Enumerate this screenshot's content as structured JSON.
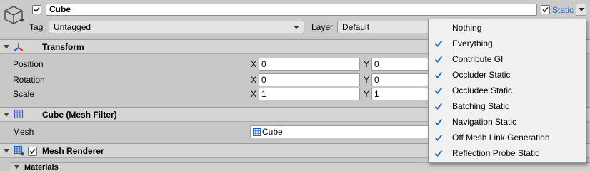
{
  "header": {
    "active": true,
    "name": "Cube",
    "static_label": "Static",
    "static_checked": true,
    "tag_label": "Tag",
    "tag_value": "Untagged",
    "layer_label": "Layer",
    "layer_value": "Default"
  },
  "transform": {
    "title": "Transform",
    "rows": [
      {
        "label": "Position",
        "x_axis": "X",
        "x": "0",
        "y_axis": "Y",
        "y": "0"
      },
      {
        "label": "Rotation",
        "x_axis": "X",
        "x": "0",
        "y_axis": "Y",
        "y": "0"
      },
      {
        "label": "Scale",
        "x_axis": "X",
        "x": "1",
        "y_axis": "Y",
        "y": "1"
      }
    ]
  },
  "mesh_filter": {
    "title": "Cube (Mesh Filter)",
    "mesh_label": "Mesh",
    "mesh_value": "Cube"
  },
  "mesh_renderer": {
    "title": "Mesh Renderer",
    "enabled": true,
    "materials_label": "Materials"
  },
  "static_menu": {
    "items": [
      {
        "label": "Nothing",
        "checked": false
      },
      {
        "label": "Everything",
        "checked": true
      },
      {
        "label": "Contribute GI",
        "checked": true
      },
      {
        "label": "Occluder Static",
        "checked": true
      },
      {
        "label": "Occludee Static",
        "checked": true
      },
      {
        "label": "Batching Static",
        "checked": true
      },
      {
        "label": "Navigation Static",
        "checked": true
      },
      {
        "label": "Off Mesh Link Generation",
        "checked": true
      },
      {
        "label": "Reflection Probe Static",
        "checked": true
      }
    ]
  },
  "colors": {
    "accent": "#1f63b8",
    "panel": "#c8c8c8",
    "menu_bg": "#f1f1f1"
  }
}
